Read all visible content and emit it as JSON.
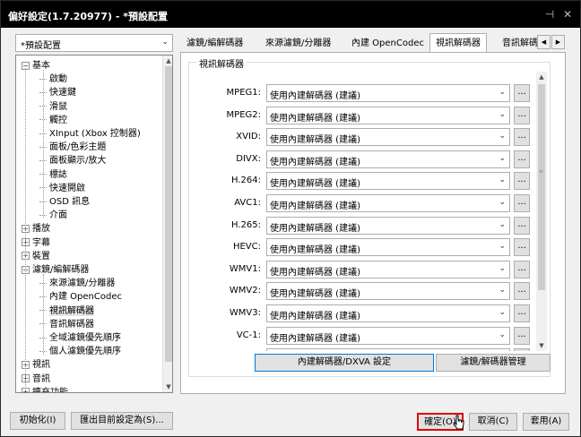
{
  "window": {
    "title": "偏好設定(1.7.20977) - *預設配置",
    "pin_icon": "pin-icon",
    "close_icon": "close-icon"
  },
  "profile": {
    "selected": "*預設配置",
    "arrow_icon": "chevron-down-icon"
  },
  "tree": {
    "items": [
      {
        "label": "基本",
        "expander": "⊟"
      },
      {
        "label": "啟動"
      },
      {
        "label": "快速鍵"
      },
      {
        "label": "滑鼠"
      },
      {
        "label": "觸控"
      },
      {
        "label": "XInput (Xbox 控制器)"
      },
      {
        "label": "面板/色彩主題"
      },
      {
        "label": "面板顯示/放大"
      },
      {
        "label": "標誌"
      },
      {
        "label": "快速開啟"
      },
      {
        "label": "OSD 訊息"
      },
      {
        "label": "介面"
      },
      {
        "label": "播放",
        "expander": "⊞"
      },
      {
        "label": "字幕",
        "expander": "⊞"
      },
      {
        "label": "裝置",
        "expander": "⊞"
      },
      {
        "label": "濾鏡/編解碼器",
        "expander": "⊟"
      },
      {
        "label": "來源濾鏡/分離器"
      },
      {
        "label": "內建 OpenCodec"
      },
      {
        "label": "視訊解碼器"
      },
      {
        "label": "音訊解碼器"
      },
      {
        "label": "全域濾鏡優先順序"
      },
      {
        "label": "個人濾鏡優先順序"
      },
      {
        "label": "視訊",
        "expander": "⊞"
      },
      {
        "label": "音訊",
        "expander": "⊞"
      },
      {
        "label": "擴充功能",
        "expander": "⊞"
      }
    ]
  },
  "tabs": [
    {
      "label": "濾鏡/編解碼器"
    },
    {
      "label": "來源濾鏡/分離器"
    },
    {
      "label": "內建 OpenCodec"
    },
    {
      "label": "視訊解碼器"
    },
    {
      "label": "音訊解碼"
    }
  ],
  "tab_arrows": {
    "left": "◀",
    "right": "▶"
  },
  "video_decoder": {
    "group_title": "視訊解碼器",
    "rows": [
      {
        "name": "MPEG1:",
        "value": "使用內建解碼器 (建議)"
      },
      {
        "name": "MPEG2:",
        "value": "使用內建解碼器 (建議)"
      },
      {
        "name": "XVID:",
        "value": "使用內建解碼器 (建議)"
      },
      {
        "name": "DIVX:",
        "value": "使用內建解碼器 (建議)"
      },
      {
        "name": "H.264:",
        "value": "使用內建解碼器 (建議)"
      },
      {
        "name": "AVC1:",
        "value": "使用內建解碼器 (建議)"
      },
      {
        "name": "H.265:",
        "value": "使用內建解碼器 (建議)"
      },
      {
        "name": "HEVC:",
        "value": "使用內建解碼器 (建議)"
      },
      {
        "name": "WMV1:",
        "value": "使用內建解碼器 (建議)"
      },
      {
        "name": "WMV2:",
        "value": "使用內建解碼器 (建議)"
      },
      {
        "name": "WMV3:",
        "value": "使用內建解碼器 (建議)"
      },
      {
        "name": "VC-1:",
        "value": "使用內建解碼器 (建議)"
      },
      {
        "name": "",
        "value": ""
      }
    ],
    "more_label": "...",
    "dxva_button": "內建解碼器/DXVA 設定",
    "manager_button": "濾鏡/解碼器管理"
  },
  "buttons": {
    "init": "初始化(I)",
    "export": "匯出目前設定為(S)...",
    "ok": "確定(O)",
    "cancel": "取消(C)",
    "apply": "套用(A)"
  }
}
